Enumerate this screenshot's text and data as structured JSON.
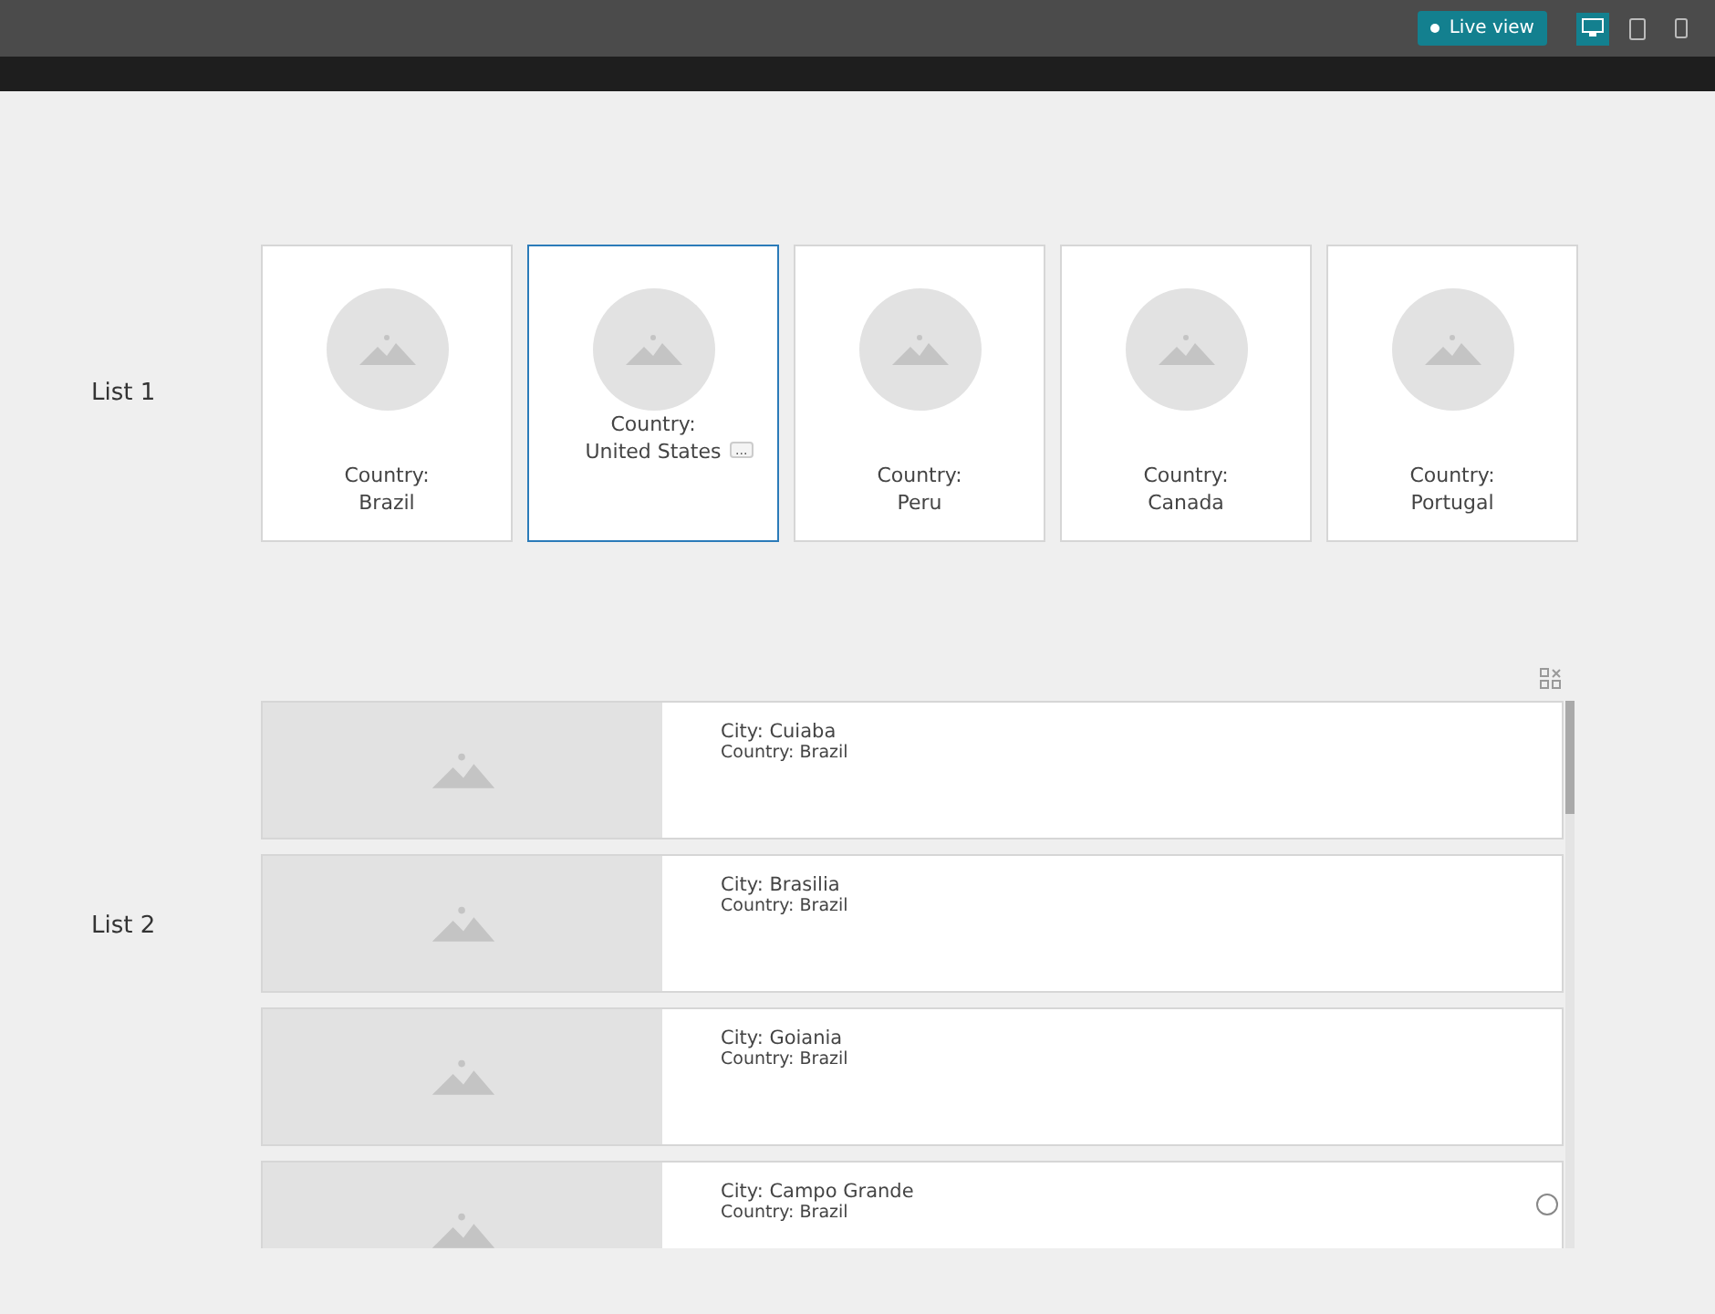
{
  "toolbar": {
    "live_view": "Live view",
    "devices": [
      {
        "kind": "desktop",
        "selected": true
      },
      {
        "kind": "tablet",
        "selected": false
      },
      {
        "kind": "phone",
        "selected": false
      }
    ]
  },
  "list1": {
    "label": "List 1",
    "cards": [
      {
        "line1": "Country:",
        "line2": "Brazil",
        "selected": false
      },
      {
        "line1": "Country:",
        "line2": "United States",
        "selected": true,
        "more": "..."
      },
      {
        "line1": "Country:",
        "line2": "Peru",
        "selected": false
      },
      {
        "line1": "Country:",
        "line2": "Canada",
        "selected": false
      },
      {
        "line1": "Country:",
        "line2": "Portugal",
        "selected": false
      }
    ]
  },
  "list2": {
    "label": "List 2",
    "rows": [
      {
        "city": "City: Cuiaba",
        "country": "Country: Brazil"
      },
      {
        "city": "City: Brasilia",
        "country": "Country: Brazil"
      },
      {
        "city": "City: Goiania",
        "country": "Country: Brazil"
      },
      {
        "city": "City: Campo Grande",
        "country": "Country: Brazil",
        "radio": {
          "checked": false
        }
      }
    ]
  }
}
